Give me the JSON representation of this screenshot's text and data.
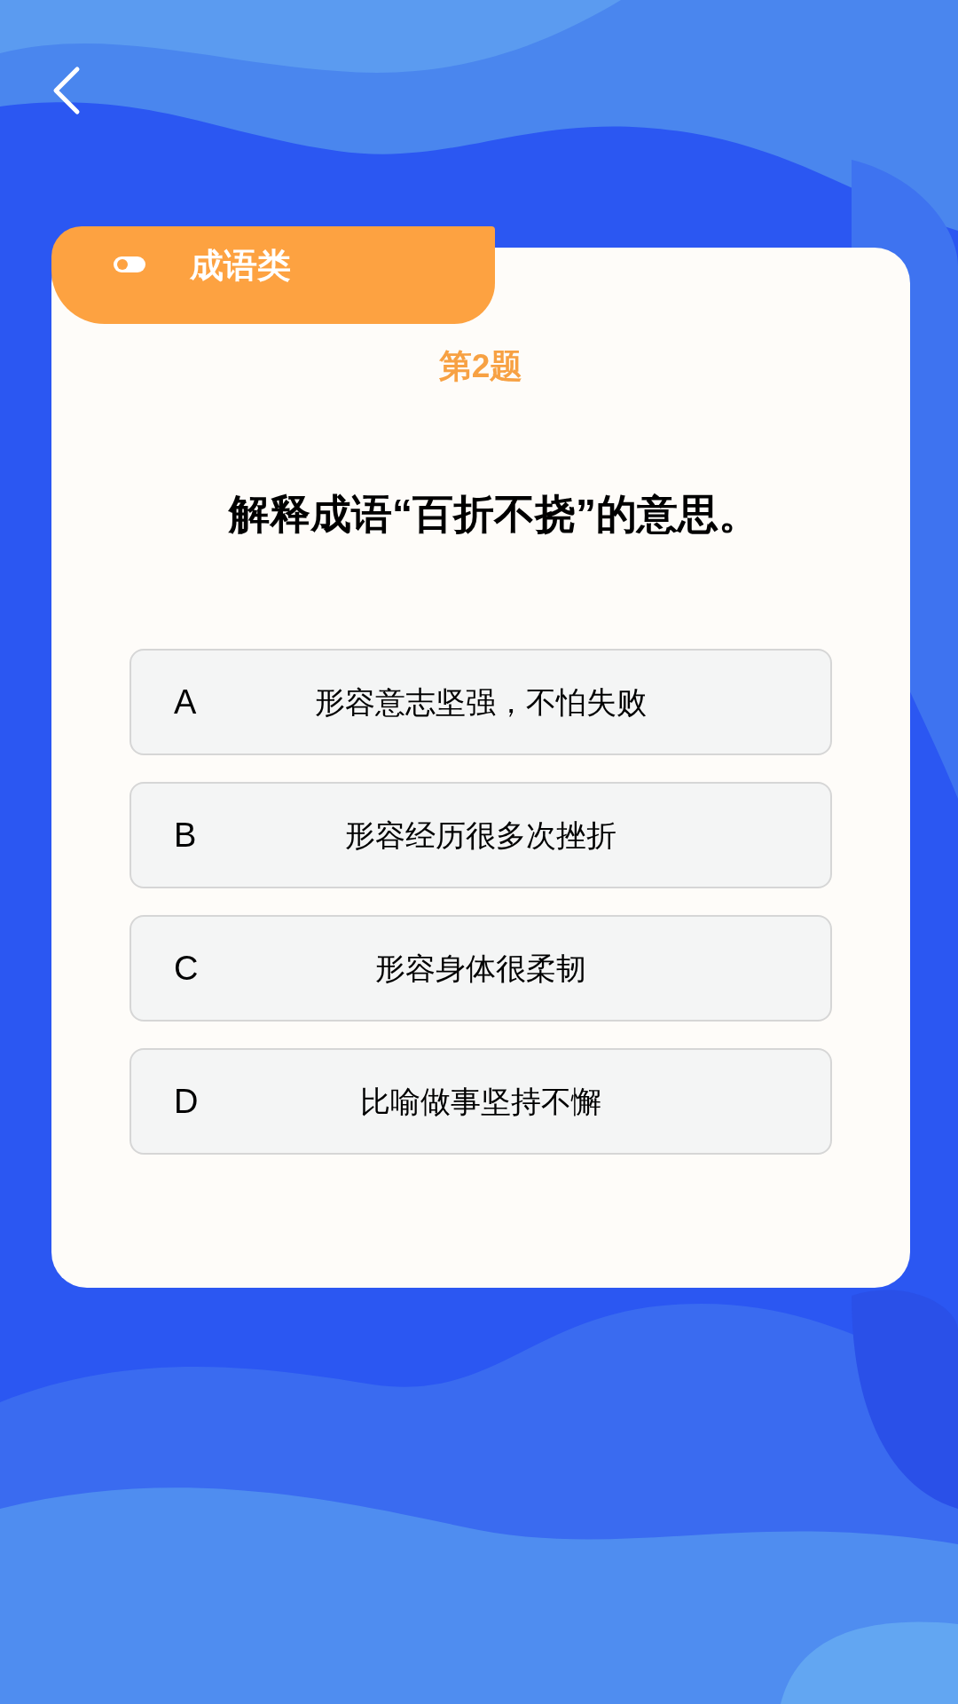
{
  "category": {
    "label": "成语类"
  },
  "question": {
    "number": "第2题",
    "text": "解释成语“百折不挠”的意思。"
  },
  "options": [
    {
      "letter": "A",
      "text": "形容意志坚强，不怕失败"
    },
    {
      "letter": "B",
      "text": "形容经历很多次挫折"
    },
    {
      "letter": "C",
      "text": "形容身体很柔韧"
    },
    {
      "letter": "D",
      "text": "比喻做事坚持不懈"
    }
  ]
}
